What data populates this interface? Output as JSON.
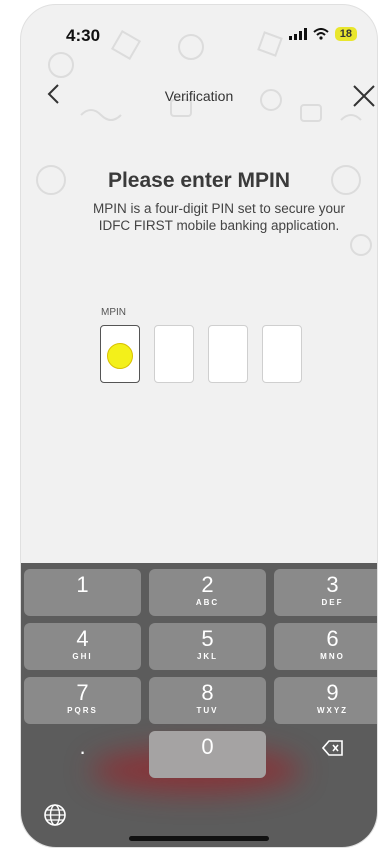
{
  "status_bar": {
    "time": "4:30",
    "battery": "18"
  },
  "nav": {
    "title": "Verification"
  },
  "content": {
    "heading": "Please enter MPIN",
    "description": "MPIN is a four-digit PIN set to secure your IDFC FIRST mobile banking application.",
    "mpin_label": "MPIN"
  },
  "keypad": {
    "keys": [
      {
        "num": "1",
        "letters": ""
      },
      {
        "num": "2",
        "letters": "ABC"
      },
      {
        "num": "3",
        "letters": "DEF"
      },
      {
        "num": "4",
        "letters": "GHI"
      },
      {
        "num": "5",
        "letters": "JKL"
      },
      {
        "num": "6",
        "letters": "MNO"
      },
      {
        "num": "7",
        "letters": "PQRS"
      },
      {
        "num": "8",
        "letters": "TUV"
      },
      {
        "num": "9",
        "letters": "WXYZ"
      }
    ],
    "dot": ".",
    "zero": "0"
  }
}
